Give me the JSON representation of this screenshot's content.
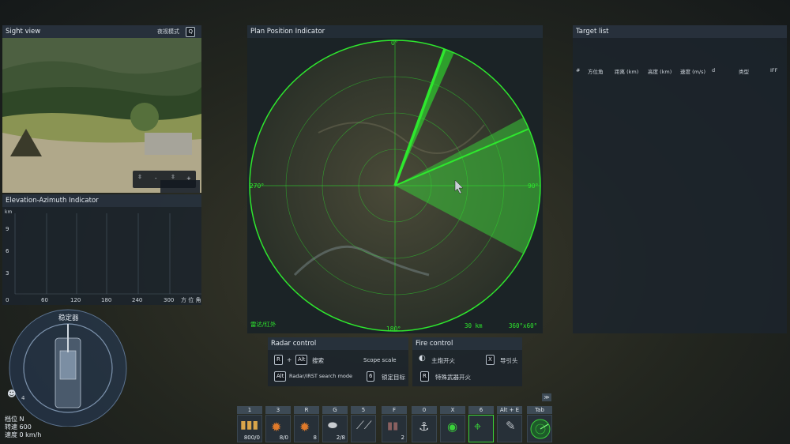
{
  "sight_view": {
    "title": "Sight view",
    "night_mode": "夜视模式",
    "night_key": "Q",
    "zoom_minus": "-",
    "zoom_plus": "+"
  },
  "ea_indicator": {
    "title": "Elevation-Azimuth Indicator",
    "y_unit": "km",
    "y_ticks": [
      "9",
      "6",
      "3",
      "0"
    ],
    "x_ticks": [
      "60",
      "120",
      "180",
      "240",
      "300"
    ],
    "x_label": "方 位 角"
  },
  "stabilizer": {
    "title": "稳定器",
    "crew_count": "4",
    "gear_label": "档位",
    "gear_value": "N",
    "rpm_label": "转速",
    "rpm_value": "600",
    "speed_label": "速度",
    "speed_value": "0 km/h"
  },
  "ppi": {
    "title": "Plan Position Indicator",
    "bearing_0": "0°",
    "bearing_90": "90°",
    "bearing_180": "180°",
    "bearing_270": "270°",
    "mode": "雷达/红外",
    "range": "30 km",
    "scan": "360°x60°",
    "sector_start_deg": 62,
    "sector_end_deg": 118,
    "sweep_deg": 67,
    "sweep2_deg": 20,
    "colors": {
      "radar": "#2ee82e",
      "sector": "#39c839"
    }
  },
  "target_list": {
    "title": "Target list",
    "columns": [
      "#",
      "方位角",
      "距离 (km)",
      "高度 (km)",
      "速度 (m/s)",
      "d",
      "类型",
      "IFF"
    ]
  },
  "radar_control": {
    "title": "Radar control",
    "key_r": "R",
    "plus": "+",
    "key_alt": "Alt",
    "search": "搜索",
    "scope_scale": "Scope scale",
    "key_alt2": "Alt",
    "search_mode": "Radar/IRST search mode",
    "key_6": "6",
    "lock_target": "锁定目标"
  },
  "fire_control": {
    "title": "Fire control",
    "main_fire": "主炮开火",
    "key_x": "X",
    "seeker": "导引头",
    "key_r": "R",
    "special_fire": "特殊武器开火"
  },
  "hotbar": [
    {
      "key": "1",
      "count": "800/0"
    },
    {
      "key": "3",
      "count": "8/0"
    },
    {
      "key": "R",
      "count": "8"
    },
    {
      "key": "G",
      "count": "2/8"
    },
    {
      "key": "5",
      "count": ""
    },
    {
      "key": "F",
      "count": "2"
    },
    {
      "key": "0",
      "count": ""
    },
    {
      "key": "X",
      "count": ""
    },
    {
      "key": "6",
      "count": ""
    },
    {
      "key": "Alt + E",
      "count": ""
    },
    {
      "key": "Tab",
      "count": ""
    }
  ],
  "expand_icon": "≫"
}
